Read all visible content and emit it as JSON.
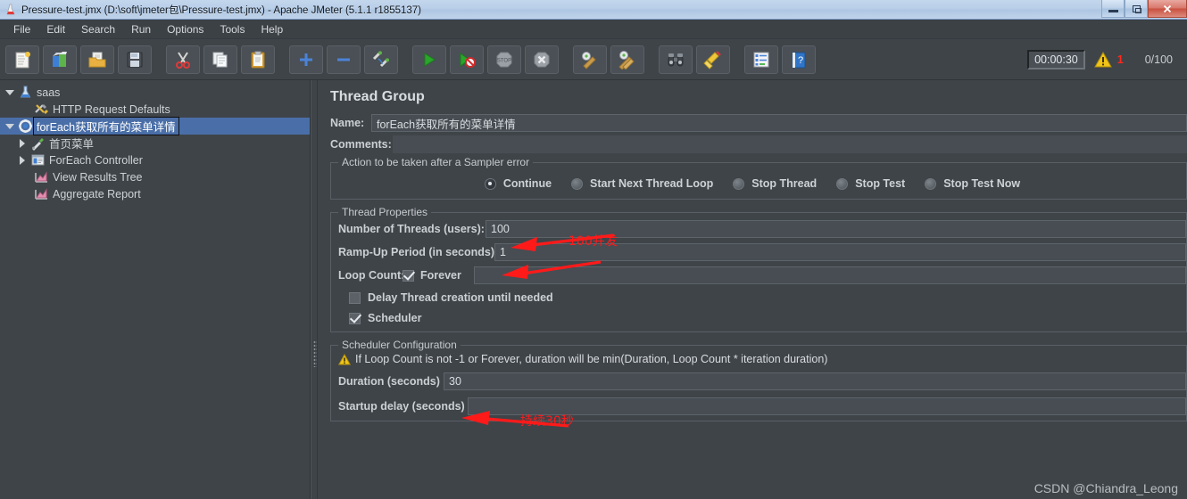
{
  "window": {
    "title": "Pressure-test.jmx (D:\\soft\\jmeter包\\Pressure-test.jmx) - Apache JMeter (5.1.1 r1855137)",
    "minimize_label": "Minimize",
    "restore_label": "Restore",
    "close_label": "Close"
  },
  "menubar": {
    "items": [
      {
        "label": "File"
      },
      {
        "label": "Edit"
      },
      {
        "label": "Search"
      },
      {
        "label": "Run"
      },
      {
        "label": "Options"
      },
      {
        "label": "Tools"
      },
      {
        "label": "Help"
      }
    ]
  },
  "toolbar": {
    "buttons": [
      {
        "name": "new-icon",
        "tooltip": "New"
      },
      {
        "name": "templates-icon",
        "tooltip": "Templates"
      },
      {
        "name": "open-folder-icon",
        "tooltip": "Open"
      },
      {
        "name": "save-icon",
        "tooltip": "Save Test Plan"
      },
      {
        "name": "cut-scissors-icon",
        "tooltip": "Cut"
      },
      {
        "name": "copy-icon",
        "tooltip": "Copy"
      },
      {
        "name": "paste-clipboard-icon",
        "tooltip": "Paste"
      },
      {
        "name": "expand-plus-icon",
        "tooltip": "Expand All"
      },
      {
        "name": "collapse-minus-icon",
        "tooltip": "Collapse All"
      },
      {
        "name": "toggle-icon",
        "tooltip": "Toggle"
      },
      {
        "name": "start-play-icon",
        "tooltip": "Start"
      },
      {
        "name": "start-no-timers-icon",
        "tooltip": "Start no pauses"
      },
      {
        "name": "stop-icon",
        "tooltip": "Stop"
      },
      {
        "name": "shutdown-icon",
        "tooltip": "Shutdown"
      },
      {
        "name": "clear-icon",
        "tooltip": "Clear"
      },
      {
        "name": "clear-all-icon",
        "tooltip": "Clear All"
      },
      {
        "name": "search-binoculars-icon",
        "tooltip": "Search"
      },
      {
        "name": "reset-search-broom-icon",
        "tooltip": "Reset Search"
      },
      {
        "name": "function-helper-icon",
        "tooltip": "Function Helper Dialog"
      },
      {
        "name": "help-icon",
        "tooltip": "Help"
      }
    ],
    "timer": "00:00:30",
    "warning_count": "1",
    "thread_count": "0/100"
  },
  "tree": {
    "items": [
      {
        "label": "saas",
        "icon": "test-plan-icon",
        "indent": 0,
        "twisty": "down",
        "selected": false
      },
      {
        "label": "HTTP Request Defaults",
        "icon": "http-defaults-icon",
        "indent": 1,
        "twisty": "none",
        "selected": false
      },
      {
        "label": "forEach获取所有的菜单详情",
        "icon": "thread-group-icon",
        "indent": 0,
        "twisty": "down",
        "selected": true
      },
      {
        "label": "首页菜单",
        "icon": "sampler-icon",
        "indent": 1,
        "twisty": "right",
        "selected": false
      },
      {
        "label": "ForEach Controller",
        "icon": "controller-icon",
        "indent": 1,
        "twisty": "right",
        "selected": false
      },
      {
        "label": "View Results Tree",
        "icon": "listener-icon",
        "indent": 1,
        "twisty": "none",
        "selected": false
      },
      {
        "label": "Aggregate Report",
        "icon": "listener-icon",
        "indent": 1,
        "twisty": "none",
        "selected": false
      }
    ]
  },
  "panel": {
    "title": "Thread Group",
    "name_label": "Name:",
    "name_value": "forEach获取所有的菜单详情",
    "comments_label": "Comments:",
    "comments_value": "",
    "sampler_error": {
      "group_title": "Action to be taken after a Sampler error",
      "options": [
        {
          "label": "Continue",
          "checked": true
        },
        {
          "label": "Start Next Thread Loop",
          "checked": false
        },
        {
          "label": "Stop Thread",
          "checked": false
        },
        {
          "label": "Stop Test",
          "checked": false
        },
        {
          "label": "Stop Test Now",
          "checked": false
        }
      ]
    },
    "thread_properties": {
      "group_title": "Thread Properties",
      "num_threads_label": "Number of Threads (users):",
      "num_threads_value": "100",
      "ramp_up_label": "Ramp-Up Period (in seconds):",
      "ramp_up_value": "1",
      "loop_count_label": "Loop Count:",
      "forever_label": "Forever",
      "forever_checked": true,
      "loop_count_value": "",
      "delay_thread_label": "Delay Thread creation until needed",
      "delay_thread_checked": false,
      "scheduler_label": "Scheduler",
      "scheduler_checked": true
    },
    "scheduler_config": {
      "group_title": "Scheduler Configuration",
      "warning_text": "If Loop Count is not -1 or Forever, duration will be min(Duration, Loop Count * iteration duration)",
      "duration_label": "Duration (seconds)",
      "duration_value": "30",
      "startup_delay_label": "Startup delay (seconds)",
      "startup_delay_value": ""
    }
  },
  "annotations": [
    {
      "text": "100并发",
      "color": "#ff1a1a"
    },
    {
      "text": "持续30秒",
      "color": "#ff1a1a"
    }
  ],
  "watermark": "CSDN @Chiandra_Leong",
  "colors": {
    "window_bg": "#3f4449",
    "field_bg": "#474d53",
    "selection_blue": "#4a6fa8",
    "text": "#cdd2d6",
    "annotation_red": "#ff1a1a",
    "warning_red": "#ff2a1e",
    "titlebar_blue": "#b9cee8"
  }
}
